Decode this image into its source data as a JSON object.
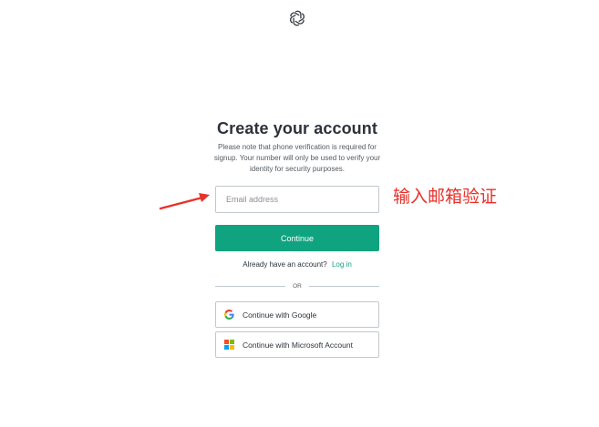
{
  "logo": {
    "icon": "openai-logo-icon"
  },
  "signup": {
    "title": "Create your account",
    "notice": "Please note that phone verification is required for signup. Your number will only be used to verify your identity for security purposes.",
    "email_placeholder": "Email address",
    "email_value": "",
    "continue_label": "Continue",
    "already_text": "Already have an account?",
    "login_link": "Log in",
    "divider_text": "OR",
    "google_label": "Continue with Google",
    "microsoft_label": "Continue with Microsoft Account"
  },
  "annotation": {
    "text": "输入邮箱验证",
    "color": "#e8312a"
  },
  "colors": {
    "accent": "#10a37f",
    "text": "#2d333a",
    "border": "#c2c8d0"
  }
}
